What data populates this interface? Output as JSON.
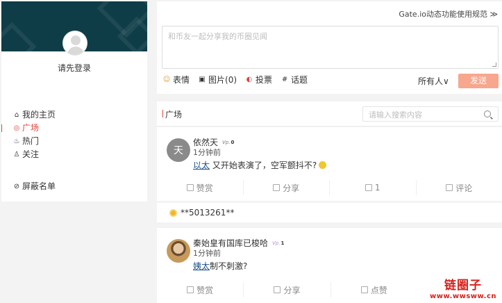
{
  "sidebar": {
    "login_prompt": "请先登录",
    "items": [
      {
        "icon": "home-icon",
        "label": "我的主页",
        "active": false
      },
      {
        "icon": "target-icon",
        "label": "广场",
        "active": true
      },
      {
        "icon": "flame-icon",
        "label": "热门",
        "active": false
      },
      {
        "icon": "user-icon",
        "label": "关注",
        "active": false
      }
    ],
    "blocked": {
      "icon": "block-icon",
      "label": "屏蔽名单"
    }
  },
  "composer": {
    "rules_link": "Gate.io动态功能使用规范 ≫",
    "placeholder": "和币友一起分享我的币圈见闻",
    "tools": [
      {
        "icon": "smile-icon",
        "label": "表情"
      },
      {
        "icon": "image-icon",
        "label": "图片(0)"
      },
      {
        "icon": "vote-icon",
        "label": "投票"
      },
      {
        "icon": "hashtag-icon",
        "label": "话题"
      }
    ],
    "audience": "所有人∨",
    "send_label": "发送"
  },
  "feed": {
    "title": "广场",
    "search_placeholder": "请输入搜索内容",
    "posts": [
      {
        "avatar_text": "天",
        "name": "依然天",
        "vip": "Vp.",
        "vip_level": "0",
        "time": "1分钟前",
        "mention": "以太",
        "text": " 又开始表演了，空军颤抖不?",
        "actions": [
          "赞赏",
          "分享",
          "1",
          "评论"
        ]
      },
      {
        "name": "秦始皇有国库已梭哈",
        "vip": "Vp.",
        "vip_level": "1",
        "time": "1分钟前",
        "mention": "姨太",
        "text": "制不刺激?",
        "actions": [
          "赞赏",
          "分享",
          "点赞"
        ]
      }
    ],
    "tip": "**5013261**"
  },
  "watermark": {
    "title": "链圈子",
    "url": "www.wwsww.cn"
  },
  "colors": {
    "accent": "#e0433a",
    "banner": "#0f3d47",
    "send": "#f7a78d"
  }
}
